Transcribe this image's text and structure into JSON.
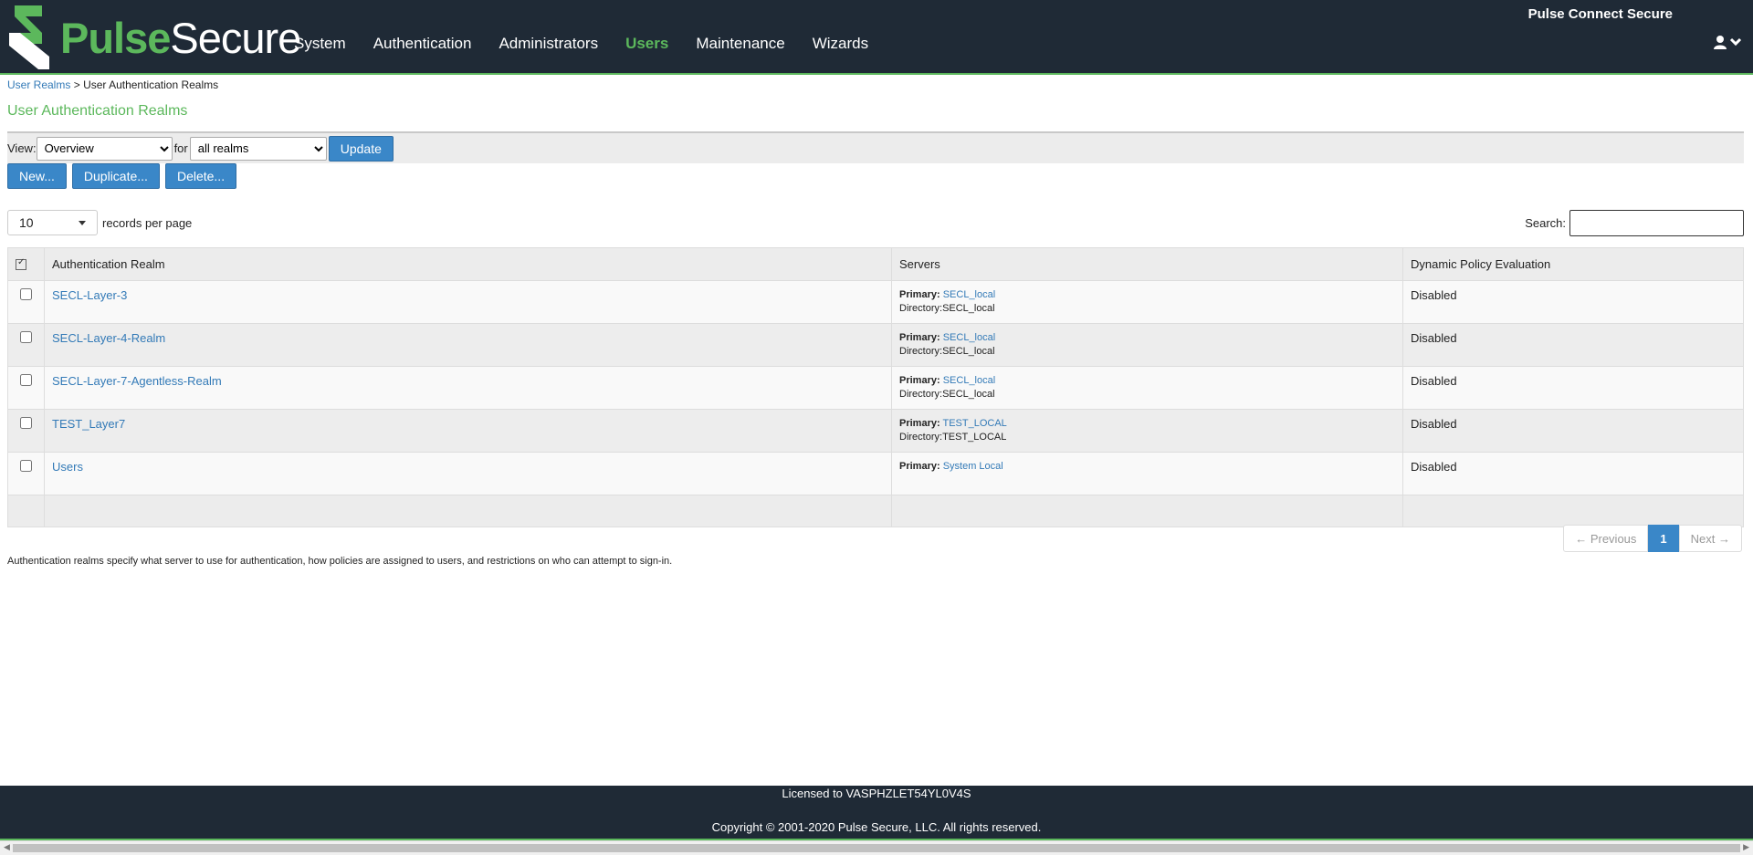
{
  "header": {
    "logo_text_1": "Pulse",
    "logo_text_2": "Secure",
    "product_name": "Pulse Connect Secure",
    "nav": [
      {
        "label": "System"
      },
      {
        "label": "Authentication"
      },
      {
        "label": "Administrators"
      },
      {
        "label": "Users",
        "active": true
      },
      {
        "label": "Maintenance"
      },
      {
        "label": "Wizards"
      }
    ],
    "user_icon": "user-icon",
    "chevron_icon": "chevron-down-icon"
  },
  "breadcrumb": {
    "parent": "User Realms",
    "separator": ">",
    "current": "User Authentication Realms"
  },
  "page_title": "User Authentication Realms",
  "view_bar": {
    "view_label": "View:",
    "view_value": "Overview",
    "for_label": "for",
    "for_value": "all realms",
    "update_label": "Update"
  },
  "actions": {
    "new_label": "New...",
    "duplicate_label": "Duplicate...",
    "delete_label": "Delete..."
  },
  "records": {
    "value": "10",
    "label": "records per page"
  },
  "search": {
    "label": "Search:",
    "value": ""
  },
  "table": {
    "headers": [
      "Authentication Realm",
      "Servers",
      "Dynamic Policy Evaluation"
    ],
    "rows": [
      {
        "realm": "SECL-Layer-3",
        "primary_label": "Primary:",
        "primary": "SECL_local",
        "directory_label": "Directory:",
        "directory": "SECL_local",
        "dpe": "Disabled"
      },
      {
        "realm": "SECL-Layer-4-Realm",
        "primary_label": "Primary:",
        "primary": "SECL_local",
        "directory_label": "Directory:",
        "directory": "SECL_local",
        "dpe": "Disabled"
      },
      {
        "realm": "SECL-Layer-7-Agentless-Realm",
        "primary_label": "Primary:",
        "primary": "SECL_local",
        "directory_label": "Directory:",
        "directory": "SECL_local",
        "dpe": "Disabled"
      },
      {
        "realm": "TEST_Layer7",
        "primary_label": "Primary:",
        "primary": "TEST_LOCAL",
        "directory_label": "Directory:",
        "directory": "TEST_LOCAL",
        "dpe": "Disabled"
      },
      {
        "realm": "Users",
        "primary_label": "Primary:",
        "primary": "System Local",
        "dpe": "Disabled"
      }
    ]
  },
  "pagination": {
    "previous_label": "← Previous",
    "current_page": "1",
    "next_label": "Next →"
  },
  "help_text": "Authentication realms specify what server to use for authentication, how policies are assigned to users, and restrictions on who can attempt to sign-in.",
  "footer": {
    "license": "Licensed to VASPHZLET54YL0V4S",
    "copyright": "Copyright © 2001-2020 Pulse Secure, LLC. All rights reserved."
  },
  "colors": {
    "brand_green": "#5cb85c",
    "header_bg": "#1f2a36",
    "button_blue": "#3a87c8",
    "link_blue": "#337ab7"
  }
}
